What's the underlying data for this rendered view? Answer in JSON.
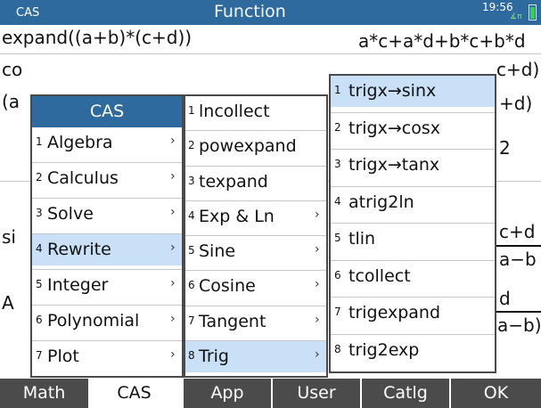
{
  "titlebar": {
    "mode": "CAS",
    "title": "Function",
    "time": "19:56",
    "angle_indicator": "∡π",
    "battery_icon": "battery-icon"
  },
  "history": {
    "line1_input": "expand((a+b)*(c+d))",
    "line1_output": "a*c+a*d+b*c+b*d",
    "line2_input_partial": "co",
    "line2_output_partial": "c+d)",
    "line3_partial": "(a",
    "line3_output_partial": "+d)",
    "line4_output_partial": "2",
    "line5_partial": "si",
    "line5_output_numerator": "c+d",
    "line5_output_denominator": "a−b",
    "line6_partial": "A",
    "line6_output_numerator": "d",
    "line6_output_denominator": "a−b)"
  },
  "cas_menu": {
    "header": "CAS",
    "items": [
      {
        "num": "1",
        "label": "Algebra",
        "arrow": "›"
      },
      {
        "num": "2",
        "label": "Calculus",
        "arrow": "›"
      },
      {
        "num": "3",
        "label": "Solve",
        "arrow": "›"
      },
      {
        "num": "4",
        "label": "Rewrite",
        "arrow": "›"
      },
      {
        "num": "5",
        "label": "Integer",
        "arrow": "›"
      },
      {
        "num": "6",
        "label": "Polynomial",
        "arrow": "›"
      },
      {
        "num": "7",
        "label": "Plot",
        "arrow": "›"
      }
    ],
    "selected_index": 3
  },
  "rewrite_menu": {
    "items": [
      {
        "num": "1",
        "label": "lncollect",
        "arrow": ""
      },
      {
        "num": "2",
        "label": "powexpand",
        "arrow": ""
      },
      {
        "num": "3",
        "label": "texpand",
        "arrow": ""
      },
      {
        "num": "4",
        "label": "Exp & Ln",
        "arrow": "›"
      },
      {
        "num": "5",
        "label": "Sine",
        "arrow": "›"
      },
      {
        "num": "6",
        "label": "Cosine",
        "arrow": "›"
      },
      {
        "num": "7",
        "label": "Tangent",
        "arrow": "›"
      },
      {
        "num": "8",
        "label": "Trig",
        "arrow": "›"
      }
    ],
    "selected_index": 7
  },
  "trig_menu": {
    "items": [
      {
        "num": "1",
        "label": "trigx→sinx"
      },
      {
        "num": "2",
        "label": "trigx→cosx"
      },
      {
        "num": "3",
        "label": "trigx→tanx"
      },
      {
        "num": "4",
        "label": "atrig2ln"
      },
      {
        "num": "5",
        "label": "tlin"
      },
      {
        "num": "6",
        "label": "tcollect"
      },
      {
        "num": "7",
        "label": "trigexpand"
      },
      {
        "num": "8",
        "label": "trig2exp"
      }
    ],
    "selected_index": 0
  },
  "softkeys": [
    {
      "label": "Math",
      "active": false
    },
    {
      "label": "CAS",
      "active": true
    },
    {
      "label": "App",
      "active": false
    },
    {
      "label": "User",
      "active": false
    },
    {
      "label": "Catlg",
      "active": false
    },
    {
      "label": "OK",
      "active": false
    }
  ],
  "colors": {
    "titlebar": "#2f6a9e",
    "selection": "#c9e0f6",
    "softkey": "#4b4b4b",
    "battery": "#36d63a"
  }
}
